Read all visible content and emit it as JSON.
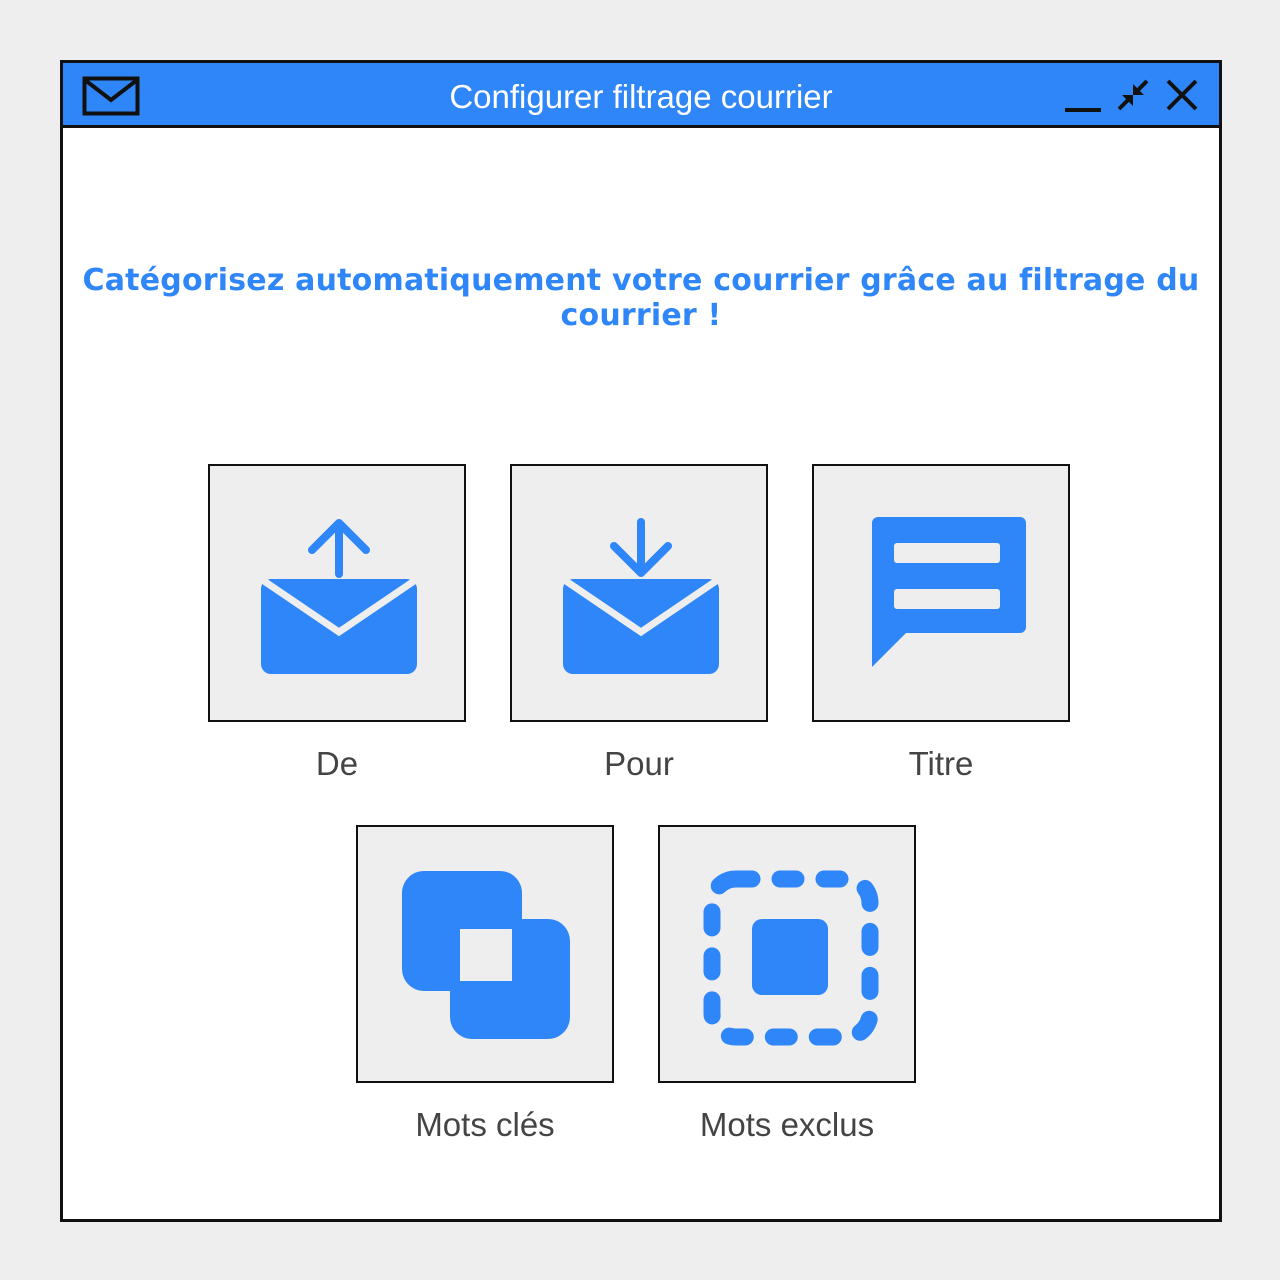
{
  "window": {
    "title": "Configurer filtrage courrier",
    "title_icon": "envelope-icon",
    "controls": [
      "minimize-icon",
      "shrink-icon",
      "close-icon"
    ]
  },
  "tagline": "Catégorisez automatiquement votre courrier grâce au filtrage du courrier !",
  "filters": [
    {
      "label": "De",
      "icon": "mail-send-icon"
    },
    {
      "label": "Pour",
      "icon": "mail-receive-icon"
    },
    {
      "label": "Titre",
      "icon": "message-bubble-icon"
    },
    {
      "label": "Mots clés",
      "icon": "overlap-squares-icon"
    },
    {
      "label": "Mots exclus",
      "icon": "dashed-select-icon"
    }
  ],
  "colors": {
    "accent": "#2f86f8",
    "tile_bg": "#eeeeee",
    "border": "#111111",
    "label": "#444444"
  }
}
